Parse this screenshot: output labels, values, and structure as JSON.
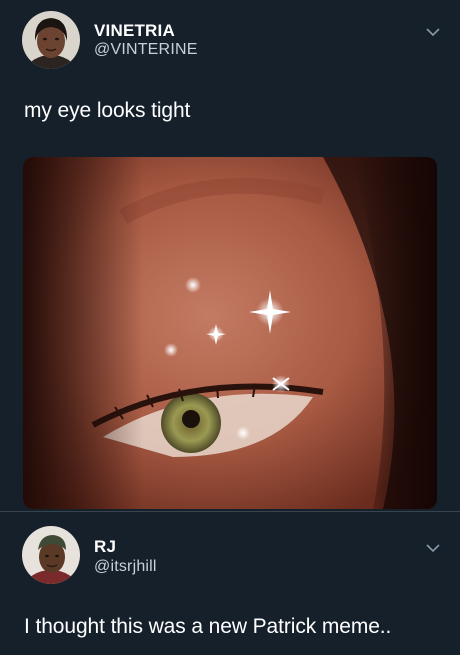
{
  "tweet1": {
    "name": "VINETRIA",
    "handle": "@VINTERINE",
    "text": "my eye looks tight",
    "media": {
      "description": "close-up of an eye with sparkle effects"
    }
  },
  "tweet2": {
    "name": "RJ",
    "handle": "@itsrjhill",
    "text": "I thought this was a new Patrick meme.."
  },
  "colors": {
    "background": "#15202b",
    "divider": "#38444d",
    "handle": "#c8d1d9",
    "chevron": "#8899a6"
  }
}
